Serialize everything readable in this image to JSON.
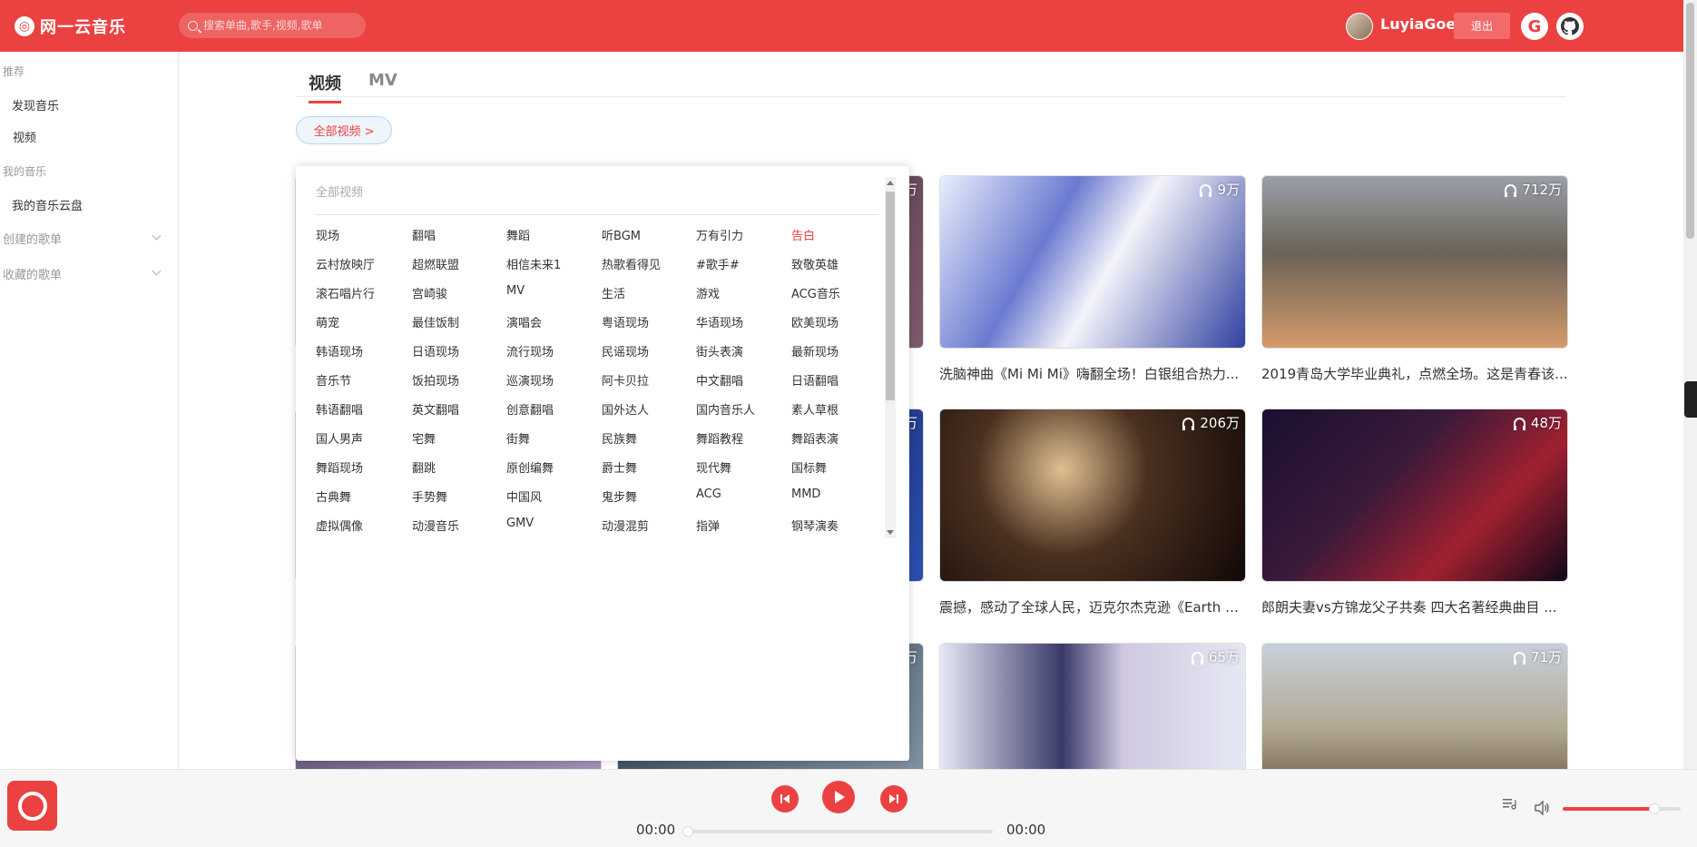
{
  "header": {
    "logo_text": "网一云音乐",
    "search_placeholder": "搜索单曲,歌手,视频,歌单",
    "username": "LuyiaGoe",
    "logout_label": "退出",
    "g_label": "G",
    "brand_color": "#ec4141"
  },
  "sidebar": {
    "section_recommend": "推荐",
    "item_discover": "发现音乐",
    "item_video": "视频",
    "section_my_music": "我的音乐",
    "item_cloud": "我的音乐云盘",
    "group_created": "创建的歌单",
    "group_collected": "收藏的歌单"
  },
  "main": {
    "tabs": [
      "视频",
      "MV"
    ],
    "all_videos_button": "全部视频 >"
  },
  "popup": {
    "header": "全部视频",
    "active_category": "告白",
    "categories": [
      [
        "现场",
        "翻唱",
        "舞蹈",
        "听BGM",
        "万有引力",
        "告白"
      ],
      [
        "云村放映厅",
        "超燃联盟",
        "相信未来1",
        "热歌看得见",
        "#歌手#",
        "致敬英雄"
      ],
      [
        "滚石唱片行",
        "宫崎骏",
        "MV",
        "生活",
        "游戏",
        "ACG音乐"
      ],
      [
        "萌宠",
        "最佳饭制",
        "演唱会",
        "粤语现场",
        "华语现场",
        "欧美现场"
      ],
      [
        "韩语现场",
        "日语现场",
        "流行现场",
        "民谣现场",
        "街头表演",
        "最新现场"
      ],
      [
        "音乐节",
        "饭拍现场",
        "巡演现场",
        "阿卡贝拉",
        "中文翻唱",
        "日语翻唱"
      ],
      [
        "韩语翻唱",
        "英文翻唱",
        "创意翻唱",
        "国外达人",
        "国内音乐人",
        "素人草根"
      ],
      [
        "国人男声",
        "宅舞",
        "街舞",
        "民族舞",
        "舞蹈教程",
        "舞蹈表演"
      ],
      [
        "舞蹈现场",
        "翻跳",
        "原创编舞",
        "爵士舞",
        "现代舞",
        "国标舞"
      ],
      [
        "古典舞",
        "手势舞",
        "中国风",
        "鬼步舞",
        "ACG",
        "MMD"
      ],
      [
        "虚拟偶像",
        "动漫音乐",
        "GMV",
        "动漫混剪",
        "指弹",
        "钢琴演奏"
      ]
    ]
  },
  "videos": [
    {
      "plays": "9万",
      "title": "洗脑神曲《Mi Mi Mi》嗨翻全场！白银组合热力..."
    },
    {
      "plays": "712万",
      "title": "2019青岛大学毕业典礼，点燃全场。这是青春该..."
    },
    {
      "plays": "206万",
      "title": "震撼，感动了全球人民，迈克尔杰克逊《Earth S..."
    },
    {
      "plays": "48万",
      "title": "郎朗夫妻vs方锦龙父子共奏 四大名著经典曲目 ..."
    },
    {
      "plays": "65万",
      "title": ""
    },
    {
      "plays": "71万",
      "title": ""
    }
  ],
  "partial_plays": [
    "万",
    "万",
    "万"
  ],
  "partial_titles": [
    "..."
  ],
  "player": {
    "current_time": "00:00",
    "total_time": "00:00",
    "progress": 0,
    "volume": 0.78
  }
}
